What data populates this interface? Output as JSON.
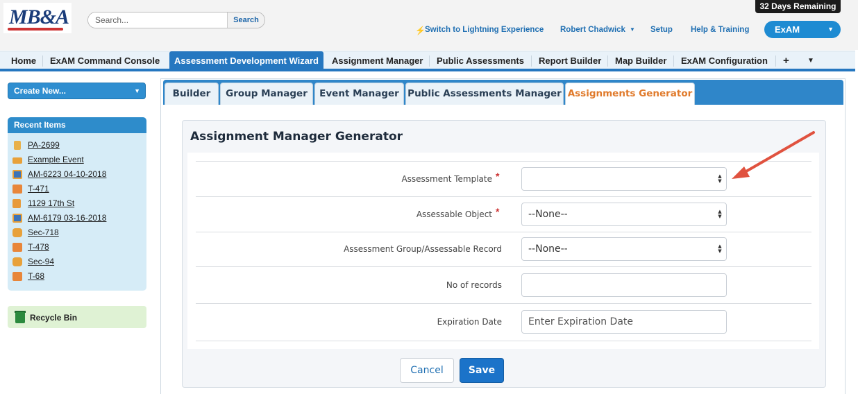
{
  "header": {
    "logo_text": "MB&A",
    "search_placeholder": "Search...",
    "search_button": "Search",
    "days_remaining": "32 Days Remaining",
    "links": {
      "lightning": "Switch to Lightning Experience",
      "user": "Robert Chadwick",
      "setup": "Setup",
      "help": "Help & Training"
    },
    "app_menu": "ExAM"
  },
  "tabs": [
    "Home",
    "ExAM Command Console",
    "Assessment Development Wizard",
    "Assignment Manager",
    "Public Assessments",
    "Report Builder",
    "Map Builder",
    "ExAM Configuration"
  ],
  "tabs_active": "Assessment Development Wizard",
  "tabs_extra": {
    "plus": "+",
    "more": "▼"
  },
  "sidebar": {
    "create_new": "Create New...",
    "recent_title": "Recent Items",
    "recent_items": [
      {
        "label": "PA-2699",
        "icon": "pa-icon",
        "color": "#e8b04a"
      },
      {
        "label": "Example Event",
        "icon": "event-icon",
        "color": "#e8a13a"
      },
      {
        "label": "AM-6223 04-10-2018",
        "icon": "assignment-icon",
        "color": "#3c74b8"
      },
      {
        "label": "T-471",
        "icon": "box-icon",
        "color": "#e8863a"
      },
      {
        "label": "1129 17th St",
        "icon": "book-icon",
        "color": "#e89a3a"
      },
      {
        "label": "AM-6179 03-16-2018",
        "icon": "assignment-icon",
        "color": "#3c74b8"
      },
      {
        "label": "Sec-718",
        "icon": "section-icon",
        "color": "#e8a13a"
      },
      {
        "label": "T-478",
        "icon": "box-icon",
        "color": "#e8863a"
      },
      {
        "label": "Sec-94",
        "icon": "section-icon",
        "color": "#e8a13a"
      },
      {
        "label": "T-68",
        "icon": "box-icon",
        "color": "#e8863a"
      }
    ],
    "recycle_bin": "Recycle Bin"
  },
  "subtabs": [
    "Builder",
    "Group Manager",
    "Event Manager",
    "Public Assessments Manager",
    "Assignments Generator"
  ],
  "subtabs_active": "Assignments Generator",
  "form": {
    "title": "Assignment Manager Generator",
    "fields": [
      {
        "label": "Assessment Template",
        "required": true,
        "type": "select",
        "value": ""
      },
      {
        "label": "Assessable Object",
        "required": true,
        "type": "select",
        "value": "--None--"
      },
      {
        "label": "Assessment Group/Assessable Record",
        "required": false,
        "type": "select",
        "value": "--None--"
      },
      {
        "label": "No of records",
        "required": false,
        "type": "text",
        "value": ""
      },
      {
        "label": "Expiration Date",
        "required": false,
        "type": "text",
        "value": "",
        "placeholder": "Enter Expiration Date"
      }
    ],
    "cancel_label": "Cancel",
    "save_label": "Save"
  },
  "colors": {
    "accent": "#2577c0",
    "active_subtab_text": "#e07a2b",
    "save_button": "#1b73c9",
    "annotation_arrow": "#e0523f"
  }
}
